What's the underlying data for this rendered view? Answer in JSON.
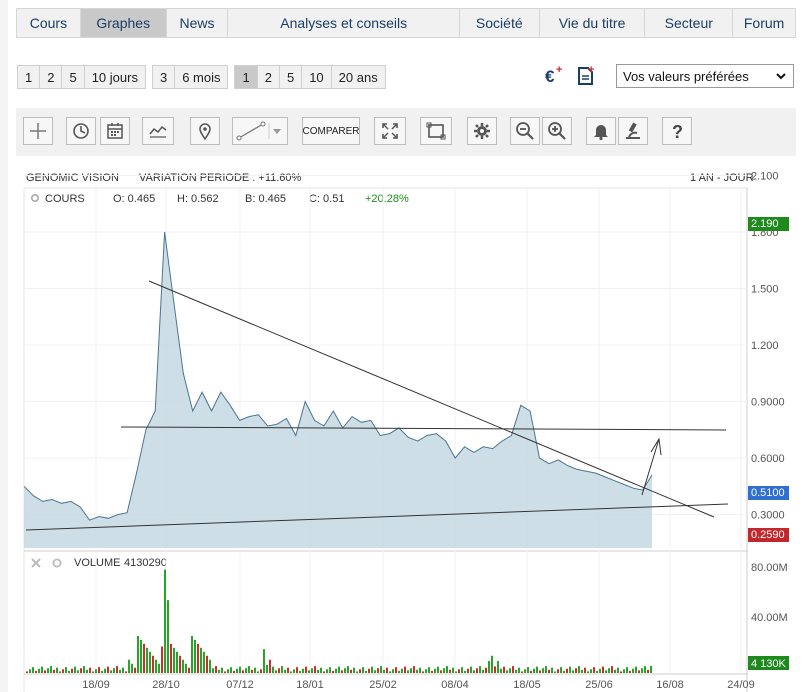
{
  "nav": {
    "items": [
      "Cours",
      "Graphes",
      "News",
      "Analyses et conseils",
      "Société",
      "Vie du titre",
      "Secteur",
      "Forum"
    ],
    "active": "Graphes"
  },
  "periods": {
    "group1": [
      "1",
      "2",
      "5",
      "10 jours"
    ],
    "group2": [
      "3",
      "6 mois"
    ],
    "group3": [
      "1",
      "2",
      "5",
      "10",
      "20 ans"
    ],
    "active": "1"
  },
  "favorites_select": {
    "selected": "Vos valeurs préférées"
  },
  "toolbar": {
    "compare_label": "COMPARER",
    "icons": [
      "crosshair-icon",
      "history-icon",
      "calendar-icon",
      "line-chart-icon",
      "pin-icon",
      "trendline-icon",
      "expand-icon",
      "fullscreen-icon",
      "settings-icon",
      "zoom-out-icon",
      "zoom-in-icon",
      "alert-bell-icon",
      "analysis-icon",
      "help-icon"
    ]
  },
  "chart_header": {
    "name": "GENOMIC VISION",
    "variation": "VARIATION PERIODE : +11.60%",
    "period": "1 AN - JOUR"
  },
  "legend": {
    "series": "COURS",
    "open": "O: 0.465",
    "high": "H: 0.562",
    "low": "B: 0.465",
    "close": "C: 0.51",
    "change": "+20.28%"
  },
  "volume_legend": {
    "label": "VOLUME",
    "value": "4130290"
  },
  "colors": {
    "area_fill": "#c5d8e2",
    "area_line": "#4a7590",
    "up": "#2aa32a",
    "down": "#d22b2b",
    "high_tag": "#1e8a1e",
    "last_tag": "#2f6fd1",
    "low_tag": "#c0282e"
  },
  "price_tags": {
    "high": "2.190",
    "last": "0.5100",
    "low": "0.2590"
  },
  "chart_data": {
    "type": "area",
    "x_ticks": [
      "18/09",
      "28/10",
      "07/12",
      "18/01",
      "25/02",
      "08/04",
      "18/05",
      "25/06",
      "16/08",
      "24/09"
    ],
    "y_ticks": [
      "2.100",
      "1.800",
      "1.500",
      "1.200",
      "0.9000",
      "0.6000",
      "0.3000"
    ],
    "price": [
      0.45,
      0.4,
      0.37,
      0.38,
      0.36,
      0.37,
      0.34,
      0.27,
      0.29,
      0.28,
      0.3,
      0.31,
      0.52,
      0.75,
      0.85,
      1.8,
      1.42,
      1.05,
      0.85,
      0.95,
      0.85,
      0.95,
      0.88,
      0.8,
      0.82,
      0.83,
      0.77,
      0.78,
      0.81,
      0.72,
      0.9,
      0.8,
      0.77,
      0.85,
      0.76,
      0.82,
      0.79,
      0.8,
      0.72,
      0.73,
      0.76,
      0.71,
      0.69,
      0.72,
      0.73,
      0.69,
      0.6,
      0.66,
      0.63,
      0.66,
      0.65,
      0.69,
      0.72,
      0.88,
      0.85,
      0.6,
      0.57,
      0.59,
      0.56,
      0.54,
      0.53,
      0.52,
      0.5,
      0.48,
      0.46,
      0.44,
      0.43,
      0.51
    ],
    "price_ylim": [
      0.2,
      2.2
    ],
    "volume_ticks": [
      "80.00M",
      "40.00M",
      "4 130K"
    ],
    "volume_ylim": [
      0,
      80000000
    ],
    "annotations": [
      {
        "type": "trendline",
        "from": [
          "28/10",
          1.84
        ],
        "to": [
          "16/08",
          0.34
        ]
      },
      {
        "type": "horizontal",
        "value": 0.9
      },
      {
        "type": "trendline",
        "from": [
          "start",
          0.25
        ],
        "to": [
          "16/08",
          0.44
        ]
      },
      {
        "type": "arrow",
        "direction": "up"
      }
    ]
  }
}
